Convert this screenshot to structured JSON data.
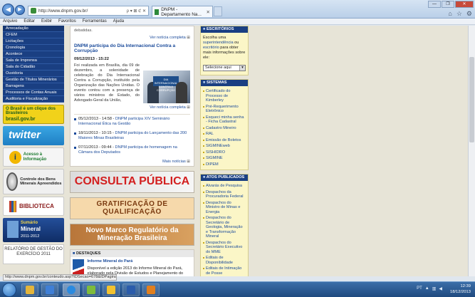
{
  "browser": {
    "url": "http://www.dnpm.gov.br/",
    "address_tools": "ρ ▾ ⊠ ℭ ✕",
    "tab_title": "DNPM - Departamento Na...",
    "window_buttons": [
      "—",
      "❐",
      "✕"
    ],
    "menu": [
      "Arquivo",
      "Editar",
      "Exibir",
      "Favoritos",
      "Ferramentas",
      "Ajuda"
    ],
    "status_url": "http://www.dnpm.gov.br/conteudo.asp?IDSecao=678&IDPagina=2366"
  },
  "left_nav": {
    "items": [
      "Arrecadação",
      "CFEM",
      "Licitações",
      "Cronologia",
      "Acontece",
      "Sala de Imprensa",
      "Sala do Cidadão",
      "Ouvidoria",
      "Gestão de Títulos Minerários",
      "Barragens",
      "Processos de Contas Anuais",
      "Auditoria e Fiscalização"
    ],
    "banner_brasil_text": "O Brasil é um clique dos Brasileiros",
    "banner_brasil_sub": "brasil.gov.br",
    "banner_twitter": "twitter",
    "banner_acesso_text": "Acesso à Informação",
    "banner_acesso_icon": "i",
    "banner_controle": "Controle dos Bens Minerais Apreendidos",
    "banner_biblioteca": "BIBLIOTECA",
    "banner_sumario_1": "Sumário",
    "banner_sumario_2": "Mineral",
    "banner_sumario_3": "2011-2012",
    "banner_relatorio": "RELATÓRIO DE GESTÃO DO EXERCÍCIO 2011"
  },
  "center": {
    "prev_tail": "debatidas.",
    "prev_more": "Ver notícia completa",
    "news_title": "DNPM participa do Dia Internacional Contra a Corrupção",
    "news_date": "09/12/2013 - 15:22",
    "news_text": "Foi realizada em Brasília, dia 09 de dezembro, a solenidade de celebração do Dia Internacional Contra a Corrupção, instituído pela Organização das Nações Unidas. O evento contou com a presença de vários ministros de Estado, do Advogado-Geral da União,",
    "photo_sign": "DIA INTERNACIONAL CONTRA A CORRUPÇÃO",
    "news_more": "Ver notícia completa",
    "list": [
      {
        "date": "05/12/2013 - 14:58 -",
        "text": "DNPM participa XIV Seminário Internacional Ética na Gestão"
      },
      {
        "date": "18/11/2013 - 10:15 -",
        "text": "DNPM participa do Lançamento das 200 Maiores Minas Brasileiras"
      },
      {
        "date": "07/11/2013 - 09:44 -",
        "text": "DNPM participa de homenagem na Câmara dos Deputados"
      }
    ],
    "more_news": "Mais notícias",
    "promo_consulta": "CONSULTA PÚBLICA",
    "promo_grat": "GRATIFICAÇÃO DE QUALIFICAÇÃO",
    "promo_marco": "Novo Marco Regulatório da Mineração Brasileira",
    "destaques_header": "DESTAQUES",
    "destaque_title": "Informe Mineral do Pará",
    "destaque_text": "Disponível a edição 2013 do Informe Mineral do Pará, elaborado pela Divisão de Estudos e Planejamento do Setor"
  },
  "right": {
    "escritorios_header": "ESCRITÓRIOS",
    "escritorios_text_1": "Escolha uma",
    "escritorios_link_1": "superintendência",
    "escritorios_text_2": "ou",
    "escritorios_link_2": "escritório",
    "escritorios_text_3": "para obter mais informações sobre ele:",
    "select_value": "Selecione aqui",
    "sistemas_header": "SISTEMAS",
    "sistemas": [
      "Certificado do Processo de Kimberley",
      "Pré-Requerimento Eletrônico",
      "Esqueci minha senha - Ficha Cadastral",
      "Cadastro Mineiro",
      "RAL",
      "Emissão de Boletos",
      "SIGMINEweb",
      "SISHIDRO",
      "SIGMINE",
      "DIPEM"
    ],
    "atos_header": "ATOS PUBLICADOS",
    "atos": [
      "Alvarás de Pesquisa",
      "Despachos da Procuradoria Federal",
      "Despachos do Ministro de Minas e Energia",
      "Despachos do Secretário de Geologia, Mineração e Transformação Mineral",
      "Despachos do Secretário Executivo do MME",
      "Editais de Disponibilidade",
      "Editais de Intimação de Posse",
      "Editais de Notificação"
    ]
  },
  "taskbar": {
    "language": "PT",
    "time": "12:39",
    "date": "18/12/2013"
  },
  "colors": {
    "nav_blue": "#1a3f82",
    "link_blue": "#1a4a9a",
    "right_box_bg": "#fbf6c7",
    "consulta_red": "#d31f1f"
  }
}
